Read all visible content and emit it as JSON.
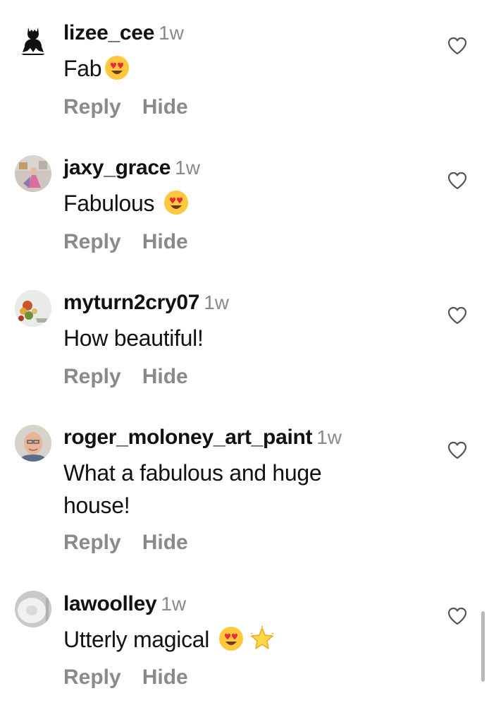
{
  "comments": [
    {
      "username": "lizee_cee",
      "time": "1w",
      "text": "Fab",
      "emojis": [
        "heart-eyes"
      ],
      "reply": "Reply",
      "hide": "Hide"
    },
    {
      "username": "jaxy_grace",
      "time": "1w",
      "text": "Fabulous ",
      "emojis": [
        "heart-eyes"
      ],
      "reply": "Reply",
      "hide": "Hide"
    },
    {
      "username": "myturn2cry07",
      "time": "1w",
      "text": "How beautiful!",
      "emojis": [],
      "reply": "Reply",
      "hide": "Hide"
    },
    {
      "username": "roger_moloney_art_paint",
      "time": "1w",
      "text": "What a fabulous and huge house!",
      "emojis": [],
      "reply": "Reply",
      "hide": "Hide"
    },
    {
      "username": "lawoolley",
      "time": "1w",
      "text": "Utterly magical ",
      "emojis": [
        "heart-eyes",
        "glowing-star"
      ],
      "reply": "Reply",
      "hide": "Hide"
    }
  ],
  "icons": {
    "like": "heart-outline-icon"
  },
  "colors": {
    "text": "#111111",
    "secondary": "#8a8a8a"
  }
}
